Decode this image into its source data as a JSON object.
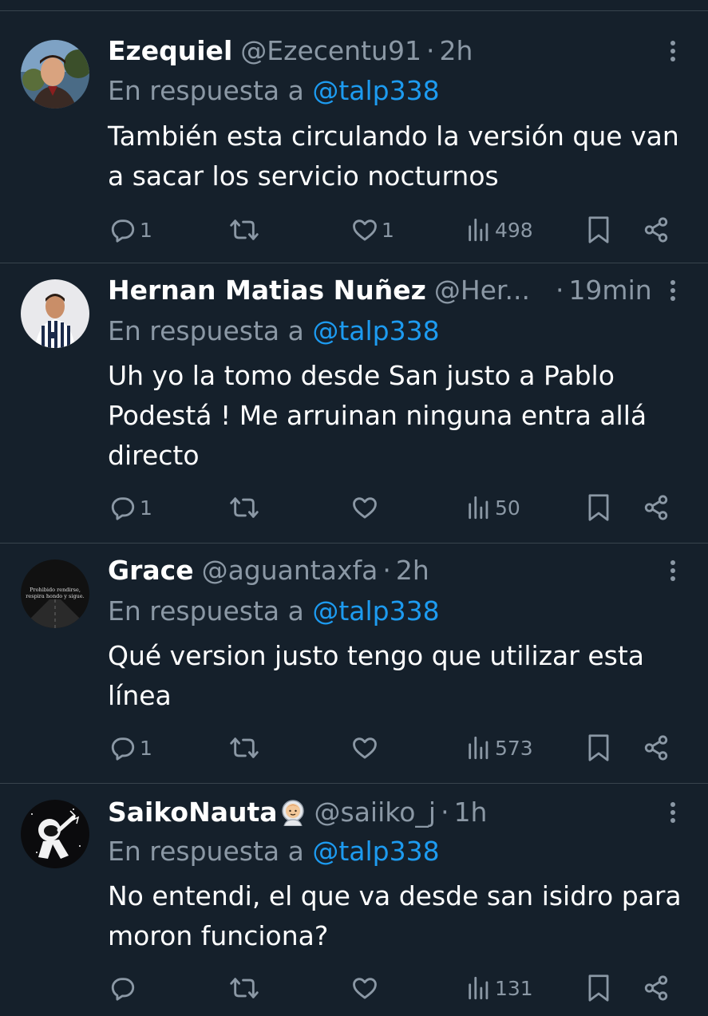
{
  "reply_prefix": "En respuesta a",
  "colors": {
    "background": "#15202b",
    "divider": "#38444d",
    "secondary_text": "#8b98a5",
    "mention": "#1d9bf0"
  },
  "tweets": [
    {
      "name": "Ezequiel",
      "handle": "@Ezecentu91",
      "dot": "·",
      "time": "2h",
      "reply_to": "@talp338",
      "text": "También esta circulando la versión  que van a sacar los servicio nocturnos",
      "replies": "1",
      "retweets": "",
      "likes": "1",
      "views": "498"
    },
    {
      "name": "Hernan Matias Nuñez",
      "handle": "@Her...",
      "dot": "·",
      "time": "19min",
      "reply_to": "@talp338",
      "text": "Uh yo la tomo desde San justo a Pablo Podestá ! Me arruinan ninguna entra allá directo",
      "replies": "1",
      "retweets": "",
      "likes": "",
      "views": "50"
    },
    {
      "name": "Grace",
      "handle": "@aguantaxfa",
      "dot": "·",
      "time": "2h",
      "reply_to": "@talp338",
      "text": "Qué version justo tengo que utilizar esta línea",
      "replies": "1",
      "retweets": "",
      "likes": "",
      "views": "573",
      "avatar_text": [
        "Prohibido rendirse,",
        "respira hondo y sigue."
      ]
    },
    {
      "name": "SaikoNauta",
      "name_emoji": "astronaut",
      "handle": "@saiiko_j",
      "dot": "·",
      "time": "1h",
      "reply_to": "@talp338",
      "text": "No entendi, el que va desde san isidro para moron funciona?",
      "replies": "",
      "retweets": "",
      "likes": "",
      "views": "131"
    }
  ],
  "icons": [
    "reply-icon",
    "retweet-icon",
    "like-icon",
    "views-icon",
    "bookmark-icon",
    "share-icon",
    "more-icon"
  ]
}
